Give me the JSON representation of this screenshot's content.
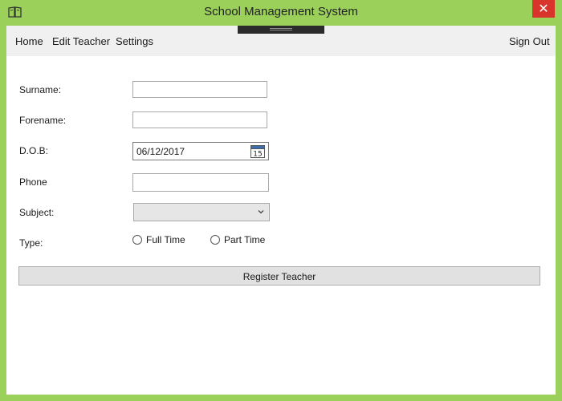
{
  "window": {
    "title": "School Management System",
    "close_glyph": "✕",
    "accent_color": "#9bd05a",
    "close_color": "#d9342b",
    "icon": "book-icon"
  },
  "menu": {
    "home": "Home",
    "edit_teacher": "Edit Teacher",
    "settings": "Settings",
    "sign_out": "Sign Out"
  },
  "form": {
    "surname_label": "Surname:",
    "surname_value": "",
    "forename_label": "Forename:",
    "forename_value": "",
    "dob_label": "D.O.B:",
    "dob_value": "06/12/2017",
    "calendar_day": "15",
    "phone_label": "Phone",
    "phone_value": "",
    "subject_label": "Subject:",
    "subject_value": "",
    "type_label": "Type:",
    "type_options": [
      "Full Time",
      "Part Time"
    ],
    "register_label": "Register Teacher"
  }
}
